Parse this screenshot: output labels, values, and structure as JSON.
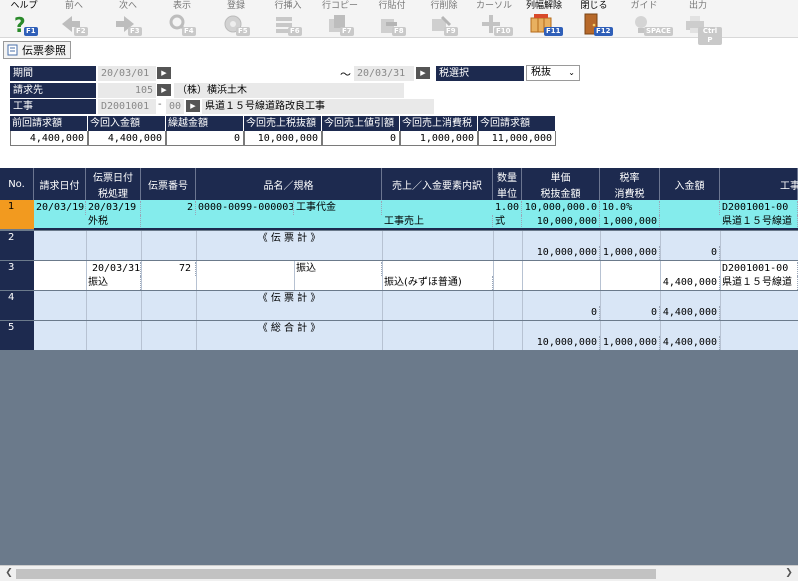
{
  "toolbar": {
    "items": [
      {
        "label": "ヘルプ",
        "key": "F1",
        "icon": "help-icon",
        "enabled": true
      },
      {
        "label": "前へ",
        "key": "F2",
        "icon": "arrow-left-icon",
        "enabled": false
      },
      {
        "label": "次へ",
        "key": "F3",
        "icon": "arrow-right-icon",
        "enabled": false
      },
      {
        "label": "表示",
        "key": "F4",
        "icon": "search-icon",
        "enabled": false
      },
      {
        "label": "登録",
        "key": "F5",
        "icon": "disk-icon",
        "enabled": false
      },
      {
        "label": "行挿入",
        "key": "F6",
        "icon": "insert-row-icon",
        "enabled": false
      },
      {
        "label": "行コピー",
        "key": "F7",
        "icon": "copy-row-icon",
        "enabled": false
      },
      {
        "label": "行貼付",
        "key": "F8",
        "icon": "paste-row-icon",
        "enabled": false
      },
      {
        "label": "行削除",
        "key": "F9",
        "icon": "delete-row-icon",
        "enabled": false
      },
      {
        "label": "カーソル",
        "key": "F10",
        "icon": "cursor-icon",
        "enabled": false
      },
      {
        "label": "列幅解除",
        "key": "F11",
        "icon": "column-width-icon",
        "enabled": true
      },
      {
        "label": "閉じる",
        "key": "F12",
        "icon": "door-icon",
        "enabled": true
      },
      {
        "label": "ガイド",
        "key": "SPACE",
        "icon": "bulb-icon",
        "enabled": false
      },
      {
        "label": "出力",
        "key": "Ctrl P",
        "icon": "print-icon",
        "enabled": false
      }
    ]
  },
  "tab": {
    "label": "伝票参照"
  },
  "form": {
    "period_label": "期間",
    "period_from": "20/03/01",
    "period_sep": "～",
    "period_to": "20/03/31",
    "tax_label": "税選択",
    "tax_value": "税抜",
    "customer_label": "請求先",
    "customer_code": "105",
    "customer_name": "（株）横浜土木",
    "project_label": "工事",
    "project_code": "D2001001",
    "project_dash": "-",
    "project_sub": "00",
    "project_name": "県道１５号線道路改良工事"
  },
  "summary": {
    "headers": [
      "前回請求額",
      "今回入金額",
      "繰越金額",
      "今回売上税抜額",
      "今回売上値引額",
      "今回売上消費税",
      "今回請求額"
    ],
    "values": [
      "4,400,000",
      "4,400,000",
      "0",
      "10,000,000",
      "0",
      "1,000,000",
      "11,000,000"
    ]
  },
  "grid": {
    "headers": {
      "no": "No.",
      "bill_date": "請求日付",
      "slip_date": "伝票日付",
      "tax_proc": "税処理",
      "slip_no": "伝票番号",
      "item": "品名／規格",
      "sales_type": "売上／入金要素内訳",
      "qty": "数量",
      "unit": "単位",
      "unit_price": "単価",
      "excl_amount": "税抜金額",
      "tax_rate": "税率",
      "tax": "消費税",
      "deposit": "入金額",
      "project": "工事"
    },
    "rows": [
      {
        "no": "1",
        "bill_date": "20/03/19",
        "slip_date": "20/03/19",
        "tax_proc": "外税",
        "slip_no": "2",
        "item1": "0000-0099-000003",
        "item2": "工事代金",
        "sales_type": "工事売上",
        "qty": "1.00",
        "unit": "式",
        "unit_price": "10,000,000.0",
        "excl_amount": "10,000,000",
        "tax_rate": "10.0%",
        "tax": "1,000,000",
        "deposit": "",
        "project1": "D2001001-00",
        "project2": "県道１５号線道"
      },
      {
        "no": "2",
        "item_center": "《 伝 票 計 》",
        "excl_amount": "10,000,000",
        "tax": "1,000,000",
        "deposit": "0"
      },
      {
        "no": "3",
        "slip_date": "20/03/31",
        "tax_proc": "振込",
        "slip_no": "72",
        "item2": "振込",
        "sales_type": "振込(みずほ普通)",
        "deposit": "4,400,000",
        "project1": "D2001001-00",
        "project2": "県道１５号線道"
      },
      {
        "no": "4",
        "item_center": "《 伝 票 計 》",
        "excl_amount": "0",
        "tax": "0",
        "deposit": "4,400,000"
      },
      {
        "no": "5",
        "item_center": "《 総 合 計 》",
        "excl_amount": "10,000,000",
        "tax": "1,000,000",
        "deposit": "4,400,000"
      }
    ]
  },
  "colors": {
    "header_navy": "#1d2a4f",
    "selected_row": "#84ecec",
    "alt_row": "#d9e6f6",
    "row_number_active": "#f29a1f",
    "grid_empty": "#6b7a8b"
  }
}
